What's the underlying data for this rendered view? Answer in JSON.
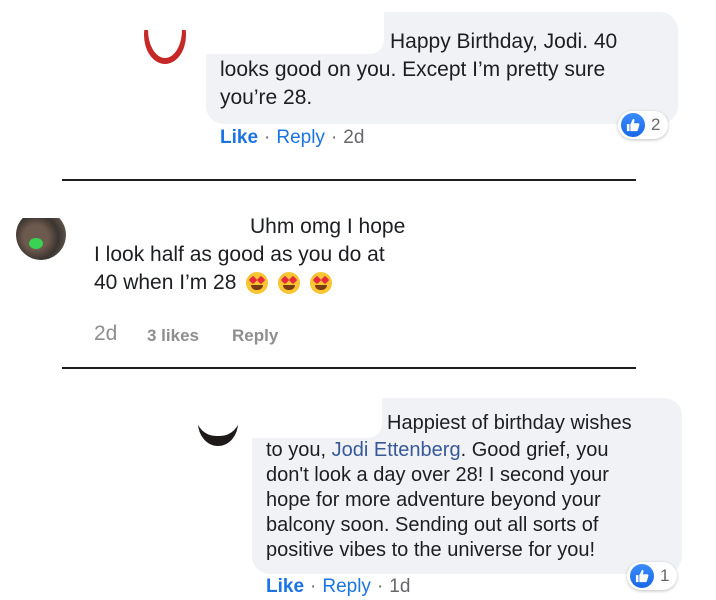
{
  "comment1": {
    "lines": [
      "Happy Birthday, Jodi. 40",
      "looks good on you. Except I’m pretty sure",
      "you’re 28."
    ],
    "reaction_count": "2",
    "like_label": "Like",
    "reply_label": "Reply",
    "separator": "·",
    "time": "2d"
  },
  "comment2": {
    "line1": "Uhm omg I hope",
    "line2": "I look half as good as you do at",
    "line3": "40 when I’m 28",
    "emoji": [
      "heart-eyes-emoji",
      "heart-eyes-emoji",
      "heart-eyes-emoji"
    ],
    "time": "2d",
    "likes": "3 likes",
    "reply_label": "Reply"
  },
  "comment3": {
    "line1": "Happiest of birthday wishes",
    "line2_prefix": "to you, ",
    "mention": "Jodi Ettenberg",
    "line2_suffix": ". Good grief, you",
    "line3": "don't look a day over 28! I second your",
    "line4": "hope for more adventure beyond your",
    "line5": "balcony soon. Sending out all sorts of",
    "line6": "positive vibes to the universe for you!",
    "reaction_count": "1",
    "like_label": "Like",
    "reply_label": "Reply",
    "separator": "·",
    "time": "1d"
  },
  "colors": {
    "facebook_blue": "#1b74e4",
    "bubble_gray": "#f0f2f5",
    "mention_blue": "#385898",
    "instagram_meta_gray": "#8e8e8e"
  }
}
